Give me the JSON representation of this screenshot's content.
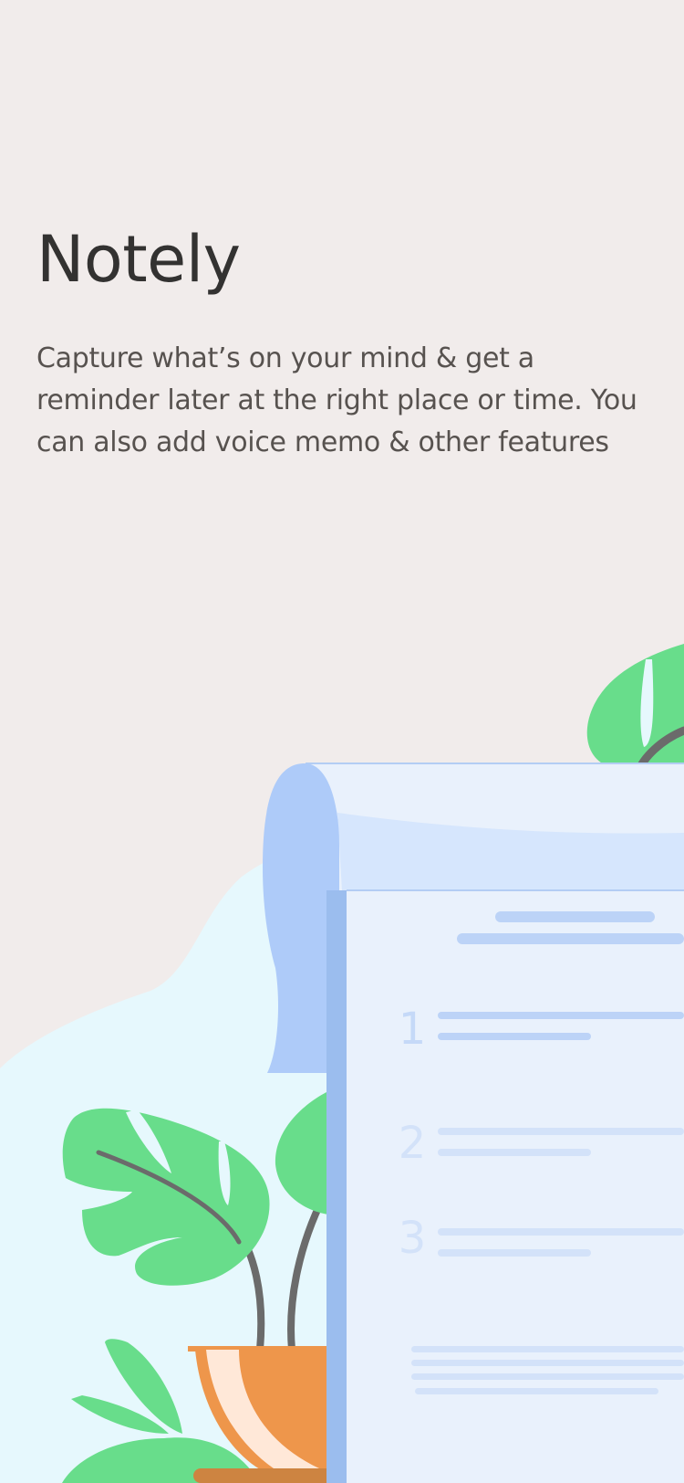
{
  "onboarding": {
    "title": "Notely",
    "description": "Capture what’s on your mind & get a reminder later at the right place or time. You can also add voice memo & other features"
  },
  "illustration": {
    "list_numbers": [
      "1",
      "2",
      "3"
    ]
  },
  "colors": {
    "background": "#f1eceb",
    "blob": "#e6f8fd",
    "leaf": "#68dd8b",
    "stem": "#6b6b6b",
    "pot": "#ee964b",
    "paper": "#e9f1fc",
    "scroll_roll": "#aecbf9",
    "paper_spine": "#9bbdee",
    "text_lines": "#bcd3f7"
  }
}
